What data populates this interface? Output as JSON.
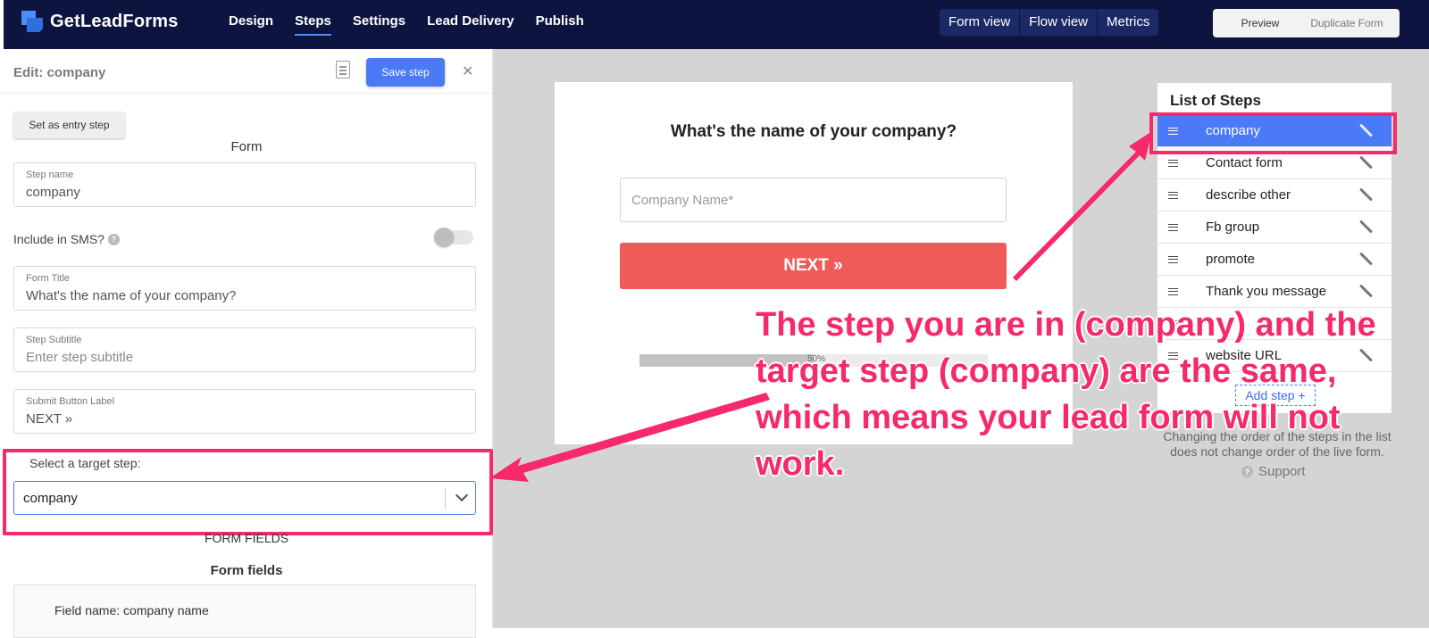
{
  "brand": {
    "name": "GetLeadForms"
  },
  "nav": {
    "items": [
      "Design",
      "Steps",
      "Settings",
      "Lead Delivery",
      "Publish"
    ],
    "active": "Steps"
  },
  "view_tabs": [
    "Form view",
    "Flow view",
    "Metrics"
  ],
  "actions": {
    "preview": "Preview",
    "duplicate": "Duplicate Form"
  },
  "editor": {
    "title": "Edit: company",
    "save_label": "Save step",
    "close_label": "✕",
    "entry_button": "Set as entry step",
    "section": "Form",
    "step_name": {
      "label": "Step name",
      "value": "company"
    },
    "sms": {
      "label": "Include in SMS?",
      "help": "?"
    },
    "form_title": {
      "label": "Form Title",
      "value": "What's the name of your company?"
    },
    "subtitle": {
      "label": "Step Subtitle",
      "placeholder": "Enter step subtitle"
    },
    "submit": {
      "label": "Submit Button Label",
      "value": "NEXT »"
    },
    "target": {
      "label": "Select a target step:",
      "value": "company"
    },
    "form_fields_caption": "FORM FIELDS",
    "form_fields_heading": "Form fields",
    "field_item": "Field name: company name"
  },
  "preview": {
    "question": "What's the name of your company?",
    "input_placeholder": "Company Name*",
    "next_label": "NEXT »",
    "progress_label": "50%",
    "progress": 0.5
  },
  "steps": {
    "title": "List of Steps",
    "items": [
      "company",
      "Contact form",
      "describe other",
      "Fb group",
      "promote",
      "Thank you message",
      "",
      "website URL"
    ],
    "active": "company",
    "add_label": "Add step +",
    "note": "Changing the order of the steps in the list does not change order of the live form.",
    "support": "Support"
  },
  "annotation": {
    "text": "The step you are in (company) and the target step (company) are the same, which means your lead form will not work.",
    "color": "#f6296b"
  },
  "colors": {
    "navbar": "#0d1440",
    "accent": "#4a7af5",
    "cta": "#ef5b58",
    "highlight": "#f6296b"
  }
}
